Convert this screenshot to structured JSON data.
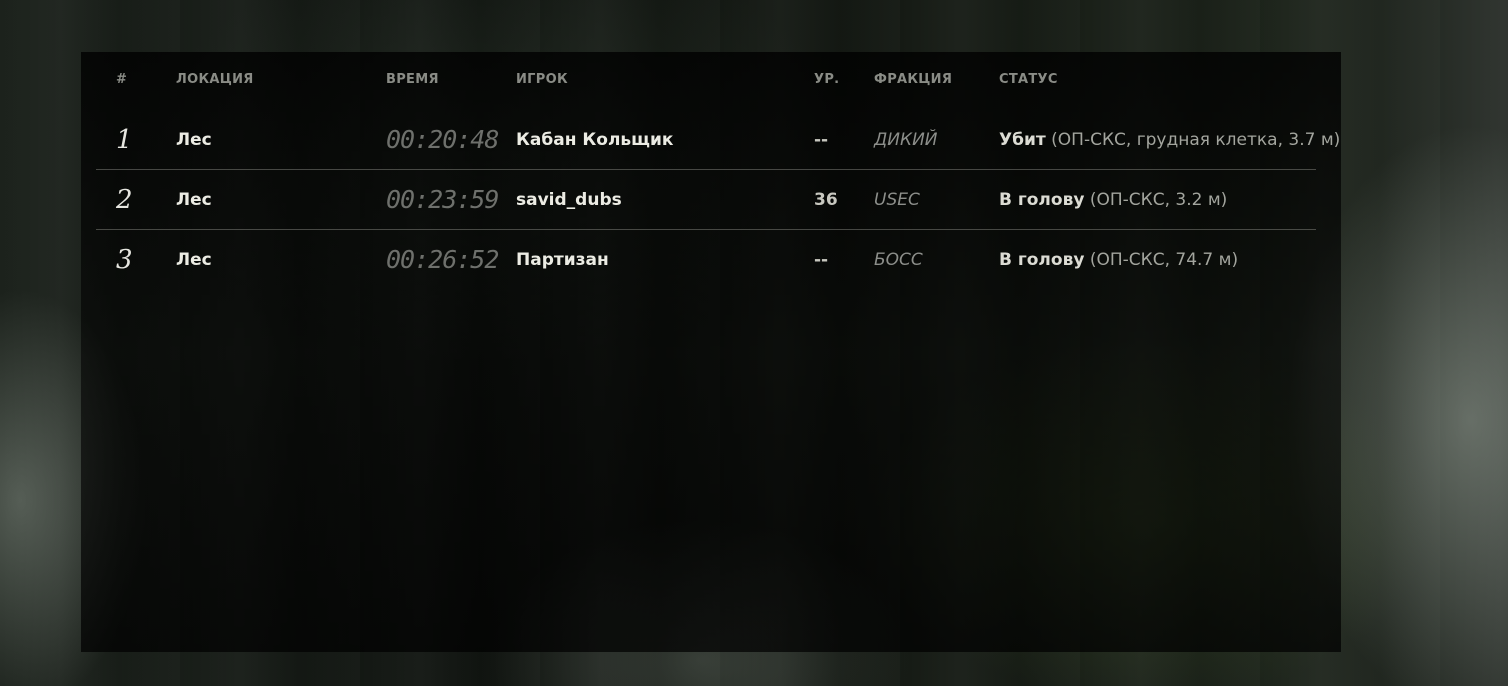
{
  "table": {
    "headers": {
      "number": "#",
      "location": "ЛОКАЦИЯ",
      "time": "ВРЕМЯ",
      "player": "ИГРОК",
      "level": "УР.",
      "faction": "ФРАКЦИЯ",
      "status": "СТАТУС"
    },
    "rows": [
      {
        "number": "1",
        "location": "Лес",
        "time": "00:20:48",
        "player": "Кабан Кольщик",
        "level": "--",
        "faction": "ДИКИЙ",
        "status_main": "Убит",
        "status_detail": " (ОП-СКС, грудная клетка, 3.7 м)"
      },
      {
        "number": "2",
        "location": "Лес",
        "time": "00:23:59",
        "player": "savid_dubs",
        "level": "36",
        "faction": "USEC",
        "status_main": "В голову",
        "status_detail": " (ОП-СКС, 3.2 м)"
      },
      {
        "number": "3",
        "location": "Лес",
        "time": "00:26:52",
        "player": "Партизан",
        "level": "--",
        "faction": "БОСС",
        "status_main": "В голову",
        "status_detail": " (ОП-СКС, 74.7 м)"
      }
    ]
  }
}
